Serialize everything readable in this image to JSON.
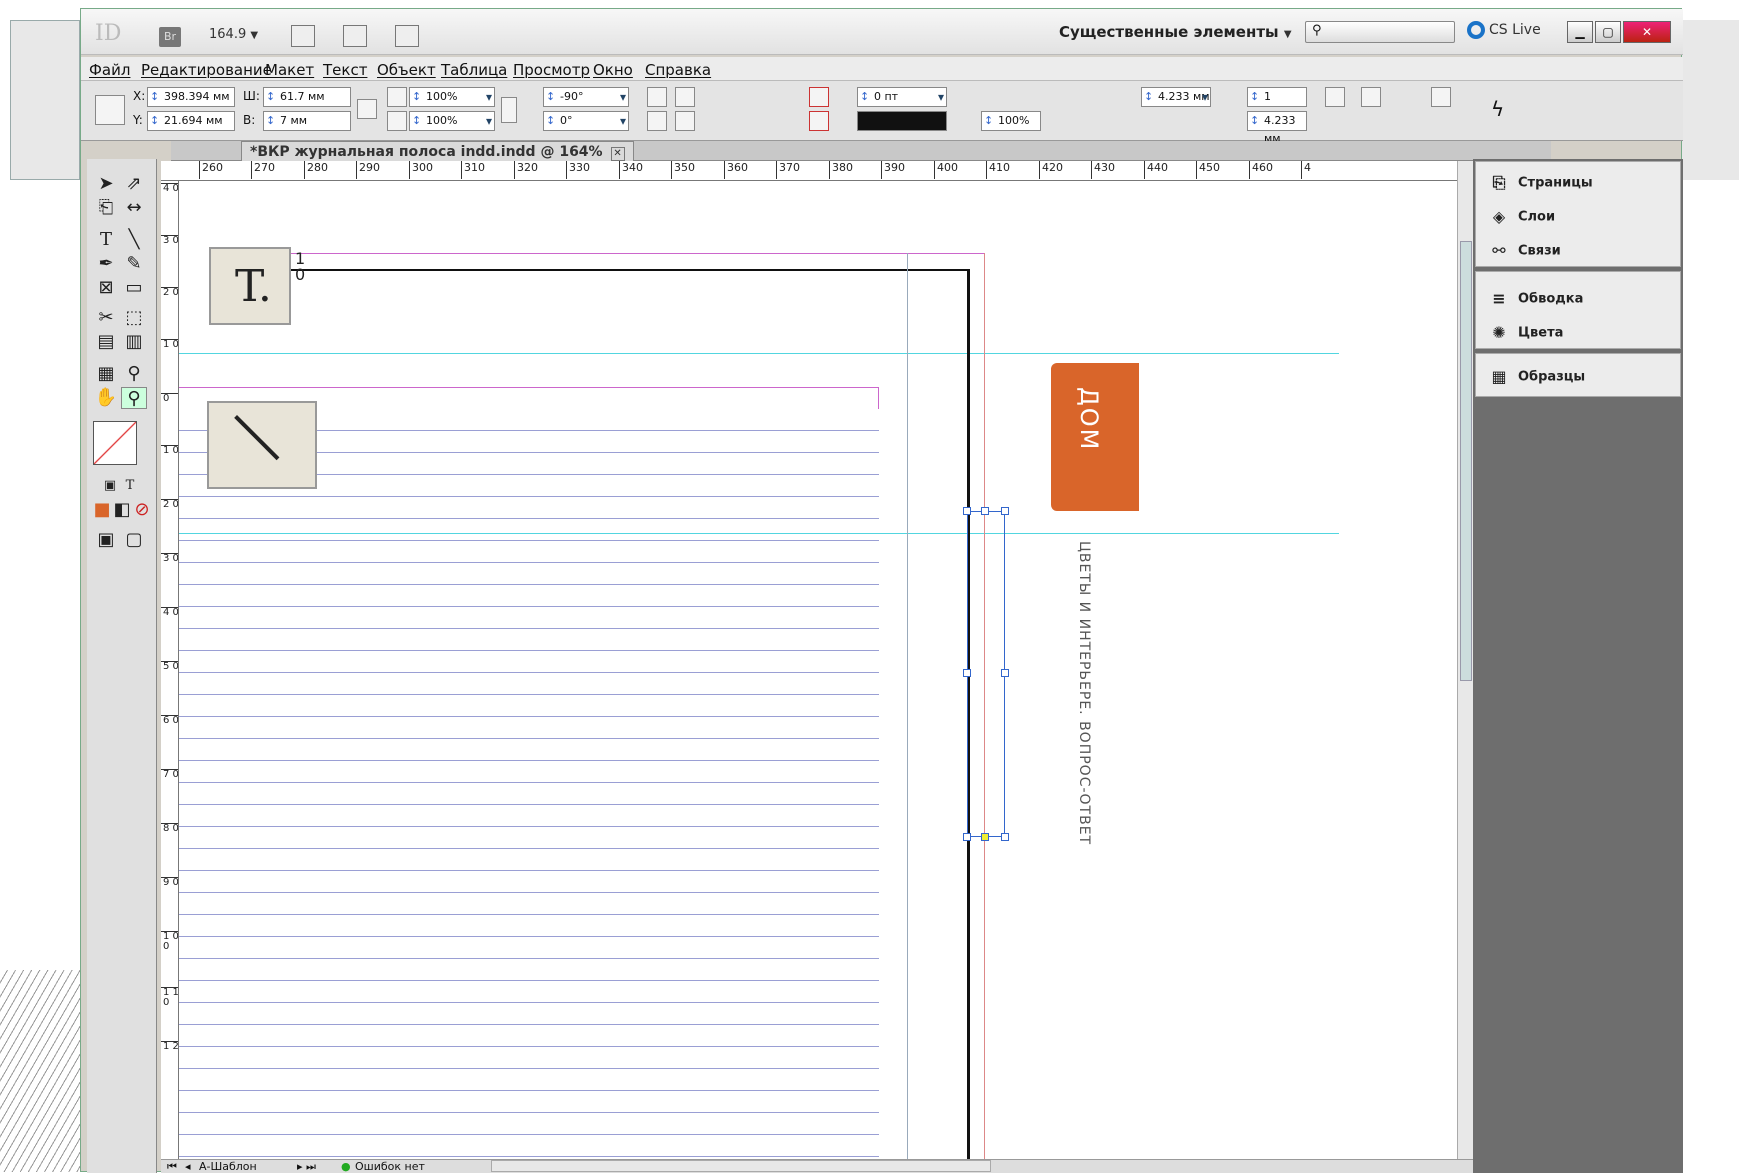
{
  "app": {
    "logo": "ID",
    "bridge_badge": "Br",
    "zoom": "164.9",
    "workspace": "Существенные элементы",
    "cs_live": "CS Live"
  },
  "menu": [
    "Файл",
    "Редактирование",
    "Макет",
    "Текст",
    "Объект",
    "Таблица",
    "Просмотр",
    "Окно",
    "Справка"
  ],
  "control": {
    "x_label": "X:",
    "x_value": "398.394 мм",
    "y_label": "Y:",
    "y_value": "21.694 мм",
    "w_label": "Ш:",
    "w_value": "61.7 мм",
    "h_label": "В:",
    "h_value": "7 мм",
    "scale_x": "100%",
    "scale_y": "100%",
    "angle": "-90°",
    "shear": "0°",
    "stroke_weight": "0 пт",
    "opacity": "100%",
    "gutter": "4.233 мм",
    "columns": "1",
    "col_gutter": "4.233 мм"
  },
  "document": {
    "tab_title": "*ВКР журнальная полоса indd.indd @ 164%",
    "close": "✕"
  },
  "ruler": {
    "top": [
      "260",
      "270",
      "280",
      "290",
      "300",
      "310",
      "320",
      "330",
      "340",
      "350",
      "360",
      "370",
      "380",
      "390",
      "400",
      "410",
      "420",
      "430",
      "440",
      "450",
      "460",
      "4"
    ],
    "left": [
      "4 0",
      "3 0",
      "2 0",
      "1 0",
      "0",
      "1 0",
      "2 0",
      "3 0",
      "4 0",
      "5 0",
      "6 0",
      "7 0",
      "8 0",
      "9 0",
      "1 0 0",
      "1 1 0",
      "1 2"
    ]
  },
  "canvas": {
    "tab_label": "ДОМ",
    "vertical_caption": "ЦВЕТЫ И ИНТЕРЬЕРЕ. ВОПРОС-ОТВЕТ",
    "zoom_text_icon": "T.",
    "zoom_tool_digit_top": "1",
    "zoom_tool_digit_bottom": "0"
  },
  "status": {
    "page": "А-Шаблон",
    "preflight": "Ошибок нет"
  },
  "panels": {
    "group1": [
      "Страницы",
      "Слои",
      "Связи"
    ],
    "group2": [
      "Обводка",
      "Цвета"
    ],
    "group3": [
      "Образцы"
    ]
  },
  "colors": {
    "tab_orange": "#d9652a",
    "guide_cyan": "#52d6e0",
    "margin_magenta": "#cc66cc",
    "baseline": "#9a9fd4"
  }
}
